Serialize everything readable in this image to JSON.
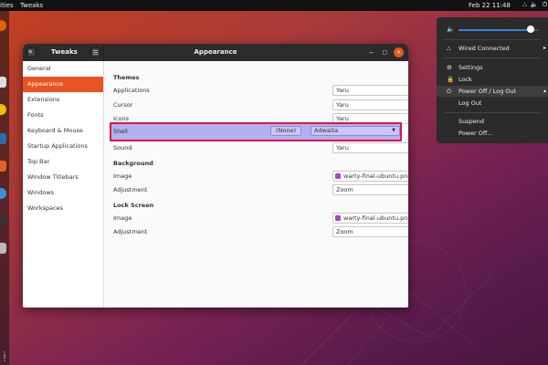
{
  "topbar": {
    "activities": "ities",
    "app_name": "Tweaks",
    "clock": "Feb 22  11:48",
    "tray_network": "⛬",
    "tray_volume": "🔈",
    "tray_power": "⏻"
  },
  "window": {
    "sidebar_title": "Tweaks",
    "title": "Appearance",
    "search_icon": "🔍",
    "menu_icon": "☰",
    "minimize": "−",
    "maximize": "□",
    "close": "✕"
  },
  "sidebar": {
    "items": [
      {
        "label": "General"
      },
      {
        "label": "Appearance"
      },
      {
        "label": "Extensions"
      },
      {
        "label": "Fonts"
      },
      {
        "label": "Keyboard & Mouse"
      },
      {
        "label": "Startup Applications"
      },
      {
        "label": "Top Bar"
      },
      {
        "label": "Window Titlebars"
      },
      {
        "label": "Windows"
      },
      {
        "label": "Workspaces"
      }
    ],
    "active_index": 1
  },
  "appearance": {
    "themes_title": "Themes",
    "applications_label": "Applications",
    "applications_value": "Yaru",
    "cursor_label": "Cursor",
    "cursor_value": "Yaru",
    "icons_label": "Icons",
    "icons_value": "Yaru",
    "shell_label": "Shell",
    "shell_none": "(None)",
    "shell_value": "Adwaita",
    "sound_label": "Sound",
    "sound_value": "Yaru",
    "background_title": "Background",
    "bg_image_label": "Image",
    "bg_image_value": "warty-final-ubuntu.png",
    "bg_adjustment_label": "Adjustment",
    "bg_adjustment_value": "Zoom",
    "lock_title": "Lock Screen",
    "lock_image_label": "Image",
    "lock_image_value": "warty-final-ubuntu.png",
    "lock_adjustment_label": "Adjustment",
    "lock_adjustment_value": "Zoom"
  },
  "system_menu": {
    "volume_level": 0.9,
    "wired": "Wired Connected",
    "settings": "Settings",
    "lock": "Lock",
    "power_off_logout": "Power Off / Log Out",
    "log_out": "Log Out",
    "suspend": "Suspend",
    "power_off": "Power Off…"
  },
  "colors": {
    "accent": "#e95420",
    "highlight_fill": "#b3b0f0",
    "highlight_border": "#d5174e"
  }
}
